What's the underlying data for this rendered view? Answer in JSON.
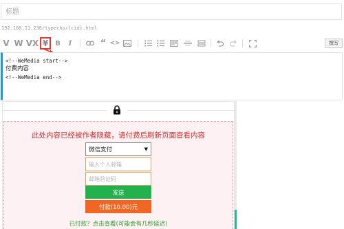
{
  "title_field": {
    "placeholder": "标题"
  },
  "permalink": "192.168.11.236/typecho/{cid}.html",
  "toolbar": {
    "items": [
      {
        "name": "v-icon",
        "glyph": "V"
      },
      {
        "name": "w-icon",
        "glyph": "W"
      },
      {
        "name": "vx-icon",
        "glyph": "VX"
      },
      {
        "name": "yen-icon",
        "glyph": "¥"
      },
      {
        "name": "bold-icon",
        "glyph": "B"
      },
      {
        "name": "italic-icon",
        "glyph": "I"
      },
      {
        "name": "link-icon"
      },
      {
        "name": "quote-icon",
        "glyph": "“"
      },
      {
        "name": "code-icon",
        "glyph": "<>"
      },
      {
        "name": "image-icon"
      },
      {
        "name": "ordered-list-icon"
      },
      {
        "name": "unordered-list-icon"
      },
      {
        "name": "heading-icon"
      },
      {
        "name": "horizontal-rule-icon"
      },
      {
        "name": "more-icon"
      },
      {
        "name": "undo-icon"
      },
      {
        "name": "redo-icon"
      },
      {
        "name": "fullscreen-icon"
      }
    ],
    "preview_label": "撰写"
  },
  "editor": {
    "line1": "<!--WeMedia start-->",
    "line2": "付费内容",
    "line3": "<!--WeMedia end-->"
  },
  "paywall": {
    "message": "此处内容已经被作者隐藏，请付费后刷新页面查看内容",
    "payment_method": "微信支付",
    "email_placeholder": "输入个人邮箱",
    "code_placeholder": "邮箱验证码",
    "send_label": "发送",
    "pay_label": "付款(10.00)元",
    "paid_link": "已付款？点击查看(可能会有几秒延迟)"
  },
  "colors": {
    "highlight": "#e53935",
    "send": "#22b14c",
    "pay": "#f26522",
    "message": "#d32f2f",
    "link": "#2e9d2e"
  }
}
